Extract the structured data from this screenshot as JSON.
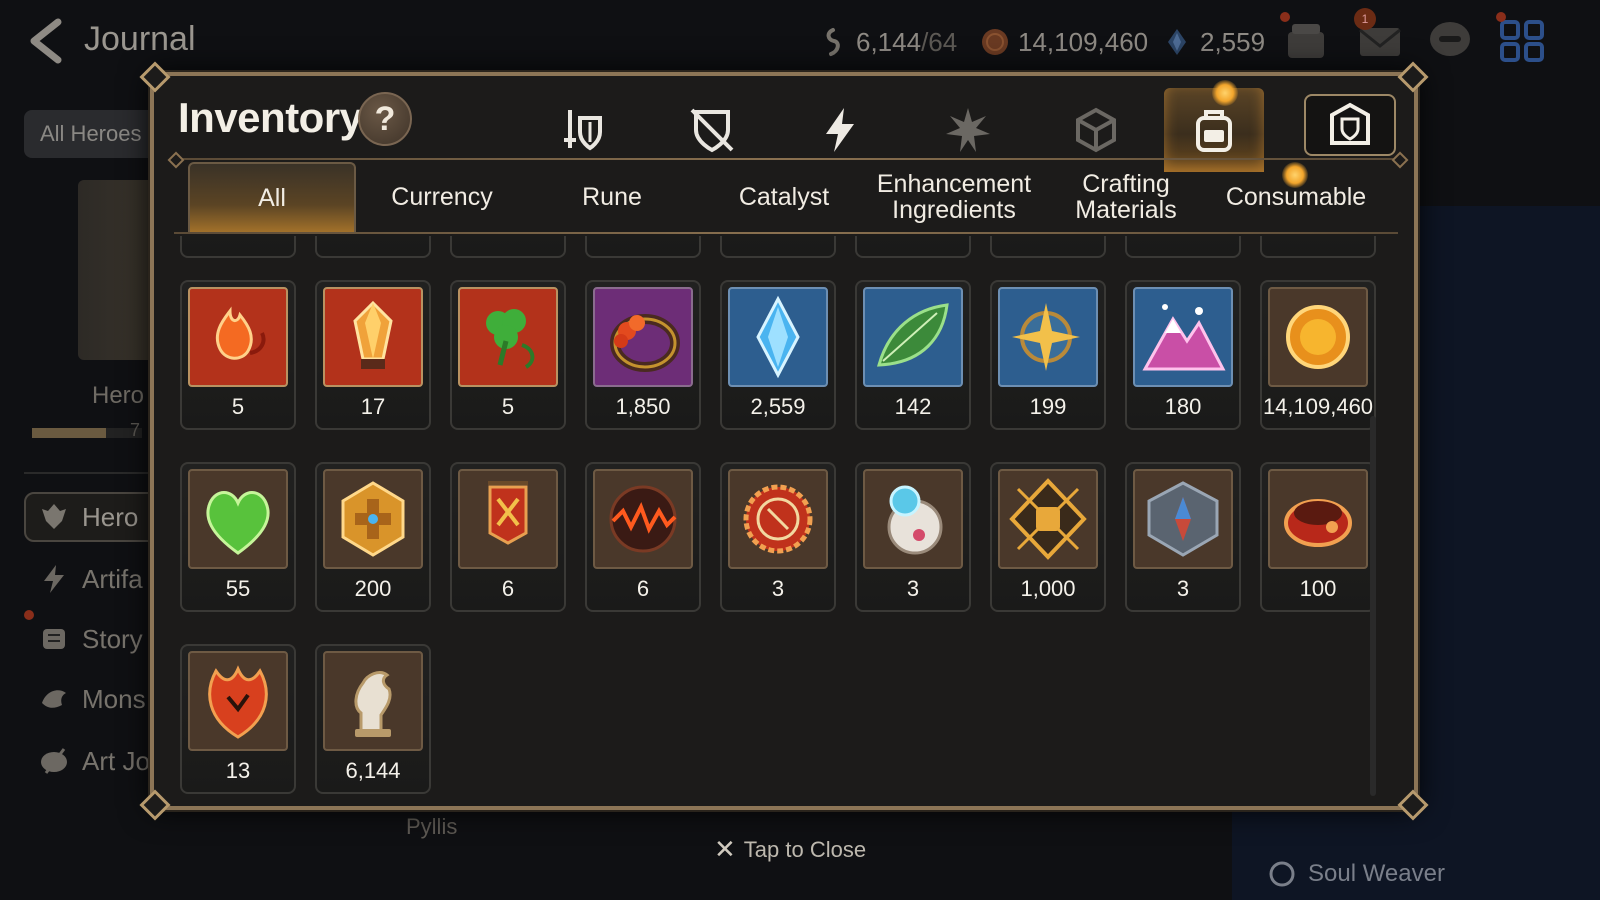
{
  "header": {
    "title": "Journal",
    "resources": [
      {
        "icon": "leifs-icon",
        "value": "6,144",
        "cap": "/64"
      },
      {
        "icon": "gold-icon",
        "value": "14,109,460"
      },
      {
        "icon": "skystone-icon",
        "value": "2,559"
      }
    ],
    "mail_badge": "1"
  },
  "background": {
    "filter_label": "All Heroes",
    "hero_label": "Hero",
    "progress_number": "7",
    "side_nav": [
      {
        "icon": "hero-icon",
        "label": "Hero"
      },
      {
        "icon": "artifact-icon",
        "label": "Artifa"
      },
      {
        "icon": "story-icon",
        "label": "Story"
      },
      {
        "icon": "monster-icon",
        "label": "Mons"
      },
      {
        "icon": "art-journal-icon",
        "label": "Art Jo"
      }
    ],
    "pyllis_label": "Pyllis",
    "soul_weaver_label": "Soul Weaver"
  },
  "inventory": {
    "title": "Inventory",
    "help_label": "?",
    "category_tabs": [
      {
        "icon": "equipment-icon",
        "active": false
      },
      {
        "icon": "broken-shield-icon",
        "active": false
      },
      {
        "icon": "lightning-icon",
        "active": false
      },
      {
        "icon": "burst-icon",
        "active": false
      },
      {
        "icon": "cube-icon",
        "active": false
      },
      {
        "icon": "backpack-icon",
        "active": true
      },
      {
        "icon": "vault-icon",
        "active": false
      }
    ],
    "sub_tabs": [
      "All",
      "Currency",
      "Rune",
      "Catalyst",
      "Enhancement\nIngredients",
      "Crafting\nMaterials",
      "Consumable"
    ],
    "active_sub_tab": "All",
    "items": [
      {
        "icon": "fire-rune-icon",
        "count": "5",
        "bg": "#b3321b",
        "frame": "ornate"
      },
      {
        "icon": "ember-crystal-icon",
        "count": "17",
        "bg": "#b3321b",
        "frame": "ornate"
      },
      {
        "icon": "clover-rune-icon",
        "count": "5",
        "bg": "#b3321b",
        "frame": "ornate"
      },
      {
        "icon": "flower-ring-icon",
        "count": "1,850",
        "bg": "#6d2d77",
        "frame": "plain"
      },
      {
        "icon": "skystone-icon",
        "count": "2,559",
        "bg": "#2d5e8f",
        "frame": "plain"
      },
      {
        "icon": "leaf-icon",
        "count": "142",
        "bg": "#2d5e8f",
        "frame": "plain"
      },
      {
        "icon": "star-compass-icon",
        "count": "199",
        "bg": "#2d5e8f",
        "frame": "plain"
      },
      {
        "icon": "crystal-mountain-icon",
        "count": "180",
        "bg": "#2d5e8f",
        "frame": "plain"
      },
      {
        "icon": "sun-coin-icon",
        "count": "14,109,460",
        "bg": "#4a382a",
        "frame": "plain"
      },
      {
        "icon": "heart-icon",
        "count": "55",
        "bg": "#4a382a",
        "frame": "plain"
      },
      {
        "icon": "golden-emblem-icon",
        "count": "200",
        "bg": "#4a382a",
        "frame": "plain"
      },
      {
        "icon": "war-banner-icon",
        "count": "6",
        "bg": "#4a382a",
        "frame": "plain"
      },
      {
        "icon": "lava-orb-icon",
        "count": "6",
        "bg": "#4a382a",
        "frame": "plain"
      },
      {
        "icon": "guild-seal-icon",
        "count": "3",
        "bg": "#4a382a",
        "frame": "plain"
      },
      {
        "icon": "robot-pet-icon",
        "count": "3",
        "bg": "#4a382a",
        "frame": "plain"
      },
      {
        "icon": "fist-badge-icon",
        "count": "1,000",
        "bg": "#4a382a",
        "frame": "plain"
      },
      {
        "icon": "stone-compass-icon",
        "count": "3",
        "bg": "#4a382a",
        "frame": "plain"
      },
      {
        "icon": "red-band-icon",
        "count": "100",
        "bg": "#4a382a",
        "frame": "plain"
      },
      {
        "icon": "flame-leaf-icon",
        "count": "13",
        "bg": "#4a382a",
        "frame": "plain"
      },
      {
        "icon": "knight-piece-icon",
        "count": "6,144",
        "bg": "#4a382a",
        "frame": "plain"
      }
    ]
  },
  "footer": {
    "close_label": "Tap to Close"
  }
}
